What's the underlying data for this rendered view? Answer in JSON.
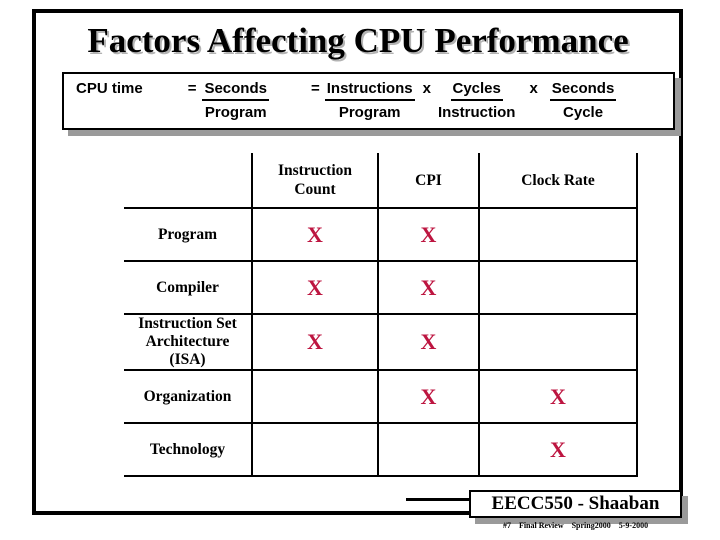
{
  "slide": {
    "title": "Factors Affecting CPU Performance"
  },
  "equation": {
    "lhs_label": "CPU time",
    "eq1": "=",
    "term1": {
      "numerator": "Seconds",
      "denominator": "Program"
    },
    "eq2": "=",
    "term2": {
      "numerator": "Instructions",
      "denominator": "Program"
    },
    "mul1": "x",
    "term3": {
      "numerator": "Cycles",
      "denominator": "Instruction"
    },
    "mul2": "x",
    "term4": {
      "numerator": "Seconds",
      "denominator": "Cycle"
    }
  },
  "table": {
    "headers": [
      "",
      "Instruction Count",
      "CPI",
      "Clock Rate"
    ],
    "rows": [
      {
        "label": "Program",
        "marks": [
          "X",
          "X",
          ""
        ]
      },
      {
        "label": "Compiler",
        "marks": [
          "X",
          "X",
          ""
        ]
      },
      {
        "label": "Instruction Set Architecture (ISA)",
        "label_line1": "Instruction Set",
        "label_line2": "Architecture (ISA)",
        "marks": [
          "X",
          "X",
          ""
        ]
      },
      {
        "label": "Organization",
        "marks": [
          "",
          "X",
          "X"
        ]
      },
      {
        "label": "Technology",
        "marks": [
          "",
          "",
          "X"
        ]
      }
    ],
    "mark_symbol": "X",
    "mark_color": "#bd1540"
  },
  "footer": {
    "course": "EECC550 - Shaaban",
    "slide_number": "#7",
    "topic": "Final Review",
    "term": "Spring2000",
    "date": "5-9-2000"
  }
}
